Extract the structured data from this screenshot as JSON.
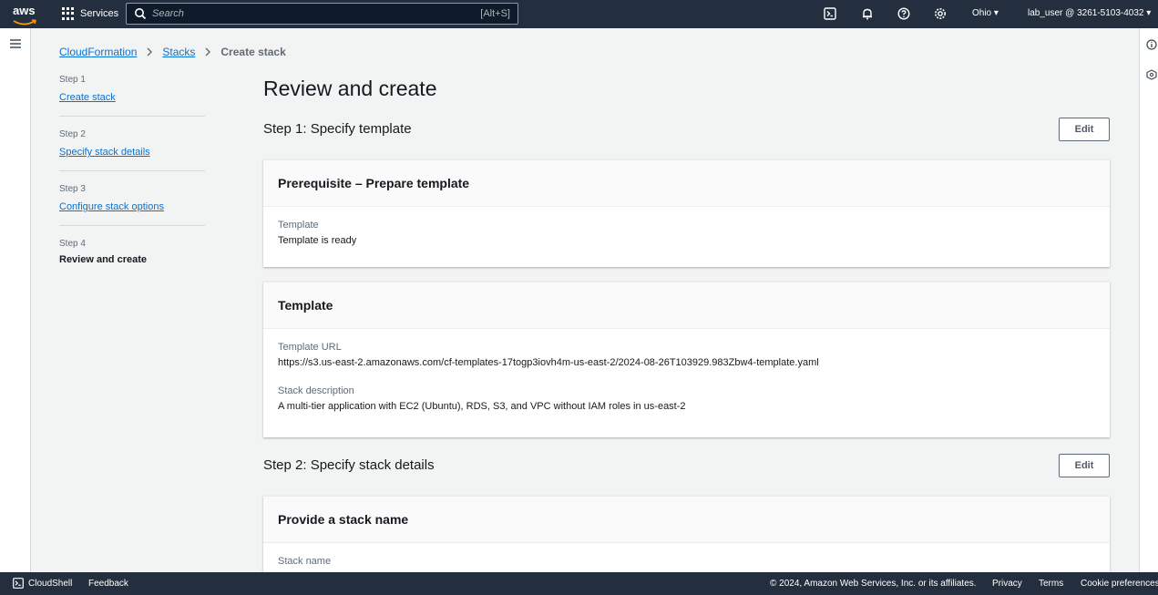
{
  "topnav": {
    "logo_text": "aws",
    "services_label": "Services",
    "search_placeholder": "Search",
    "search_shortcut": "[Alt+S]",
    "region": "Ohio ▾",
    "account": "lab_user @ 3261-5103-4032 ▾"
  },
  "breadcrumb": {
    "items": [
      "CloudFormation",
      "Stacks"
    ],
    "current": "Create stack"
  },
  "steps": [
    {
      "num": "Step 1",
      "label": "Create stack"
    },
    {
      "num": "Step 2",
      "label": "Specify stack details"
    },
    {
      "num": "Step 3",
      "label": "Configure stack options"
    },
    {
      "num": "Step 4",
      "label": "Review and create"
    }
  ],
  "main": {
    "title": "Review and create",
    "section1": {
      "heading": "Step 1: Specify template",
      "edit_label": "Edit",
      "card1": {
        "title": "Prerequisite – Prepare template",
        "template_label": "Template",
        "template_value": "Template is ready"
      },
      "card2": {
        "title": "Template",
        "url_label": "Template URL",
        "url_value": "https://s3.us-east-2.amazonaws.com/cf-templates-17togp3iovh4m-us-east-2/2024-08-26T103929.983Zbw4-template.yaml",
        "desc_label": "Stack description",
        "desc_value": "A multi-tier application with EC2 (Ubuntu), RDS, S3, and VPC without IAM roles in us-east-2"
      }
    },
    "section2": {
      "heading": "Step 2: Specify stack details",
      "edit_label": "Edit",
      "card1": {
        "title": "Provide a stack name",
        "name_label": "Stack name"
      }
    }
  },
  "footer": {
    "cloudshell": "CloudShell",
    "feedback": "Feedback",
    "copyright": "© 2024, Amazon Web Services, Inc. or its affiliates.",
    "privacy": "Privacy",
    "terms": "Terms",
    "cookies": "Cookie preferences"
  }
}
